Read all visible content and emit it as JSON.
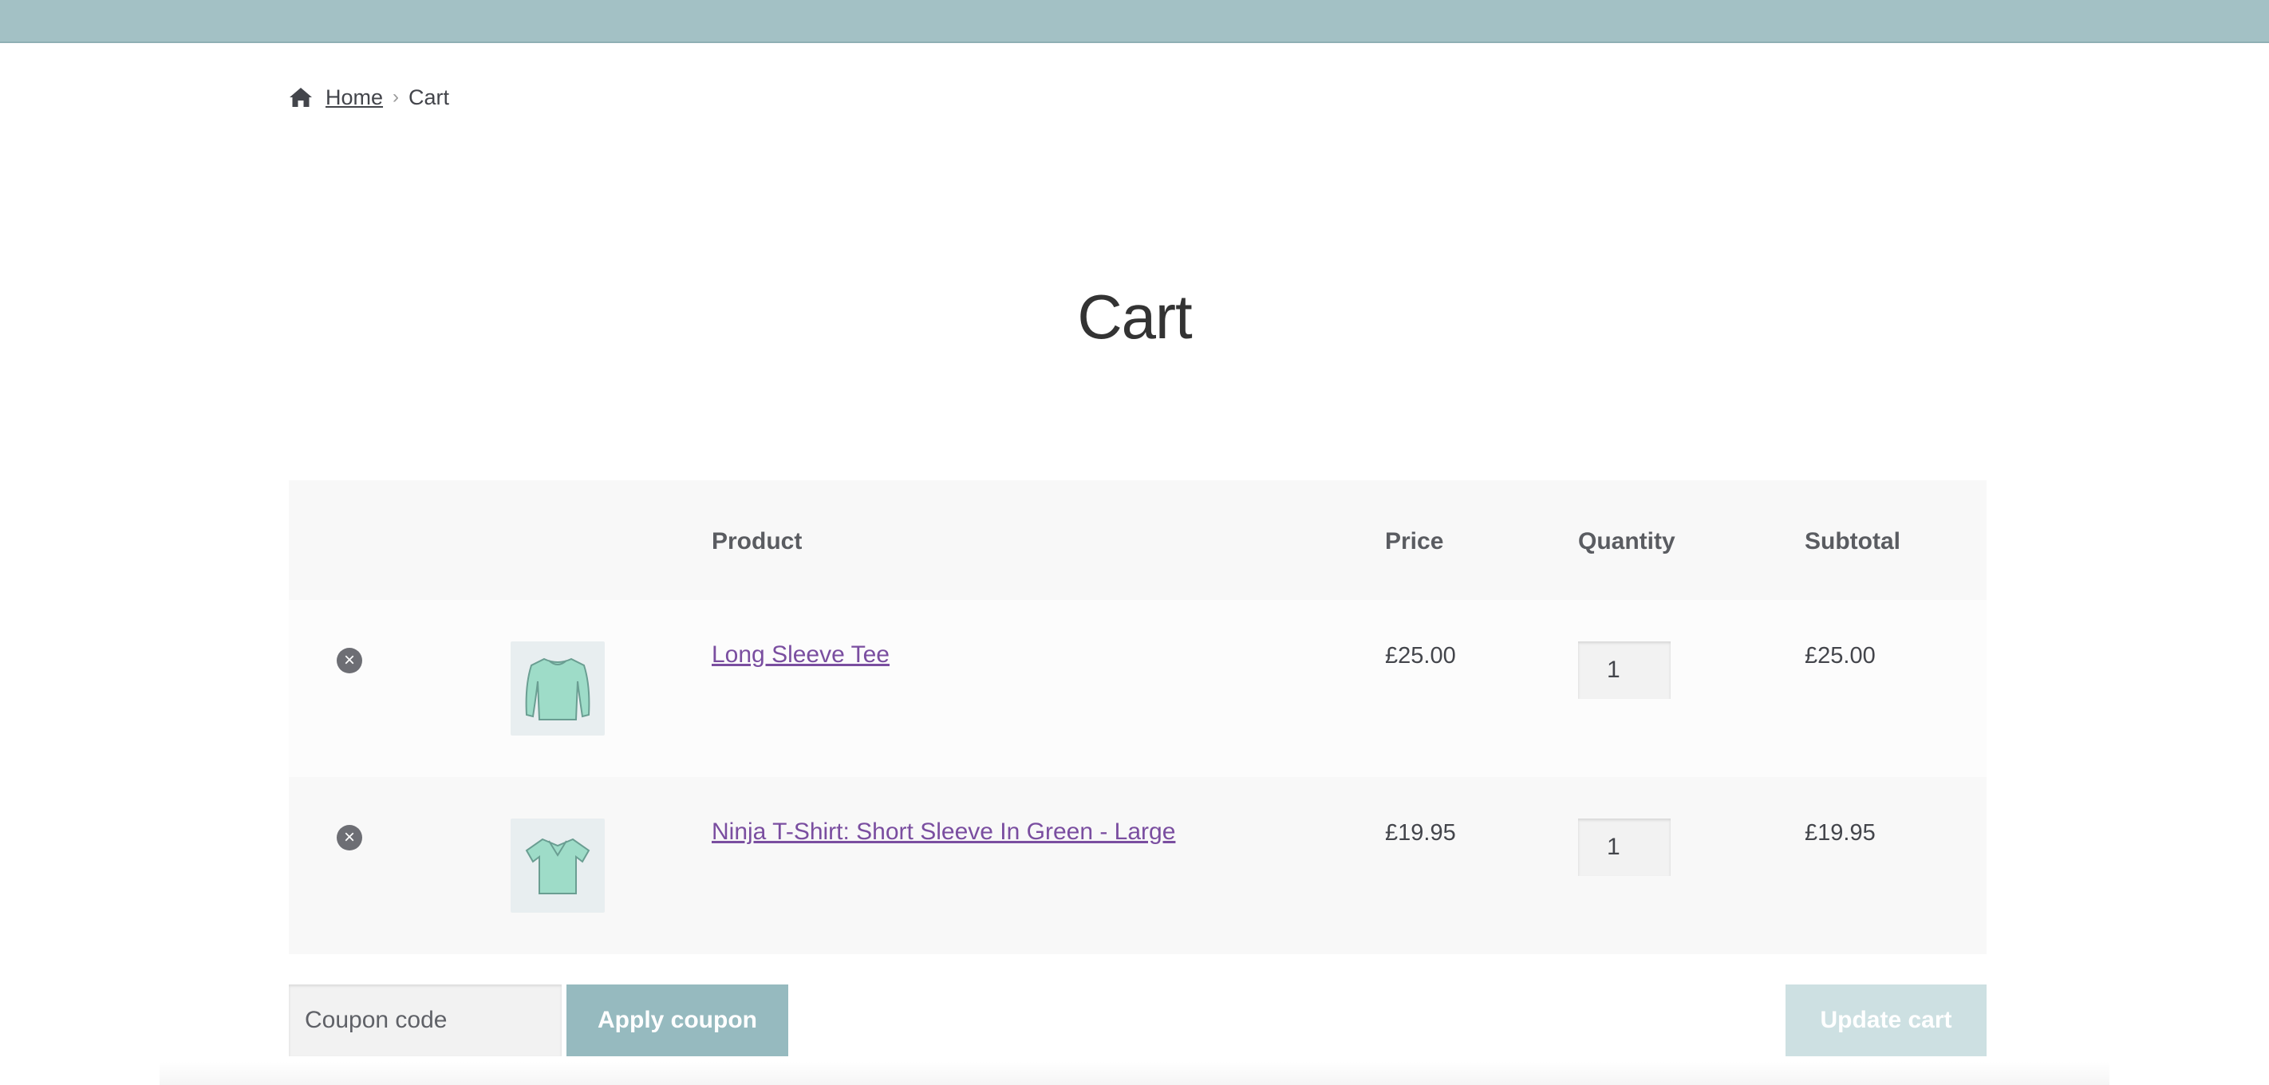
{
  "colors": {
    "topbar": "#a3c1c5",
    "link": "#7a4ea0",
    "apply_button": "#96babf",
    "update_button": "#cde0e2",
    "table_header_bg": "#f8f8f8"
  },
  "breadcrumb": {
    "icon": "home-icon",
    "home_label": "Home",
    "separator": "›",
    "current": "Cart"
  },
  "page": {
    "title": "Cart"
  },
  "table": {
    "headers": {
      "product": "Product",
      "price": "Price",
      "quantity": "Quantity",
      "subtotal": "Subtotal"
    },
    "rows": [
      {
        "remove_icon": "remove-circle-icon",
        "thumbnail": "long-sleeve-tee-thumbnail",
        "name": "Long Sleeve Tee",
        "price": "£25.00",
        "quantity": "1",
        "subtotal": "£25.00"
      },
      {
        "remove_icon": "remove-circle-icon",
        "thumbnail": "ninja-t-shirt-thumbnail",
        "name": "Ninja T-Shirt: Short Sleeve In Green - Large",
        "price": "£19.95",
        "quantity": "1",
        "subtotal": "£19.95"
      }
    ]
  },
  "actions": {
    "coupon_placeholder": "Coupon code",
    "apply_label": "Apply coupon",
    "update_label": "Update cart"
  }
}
